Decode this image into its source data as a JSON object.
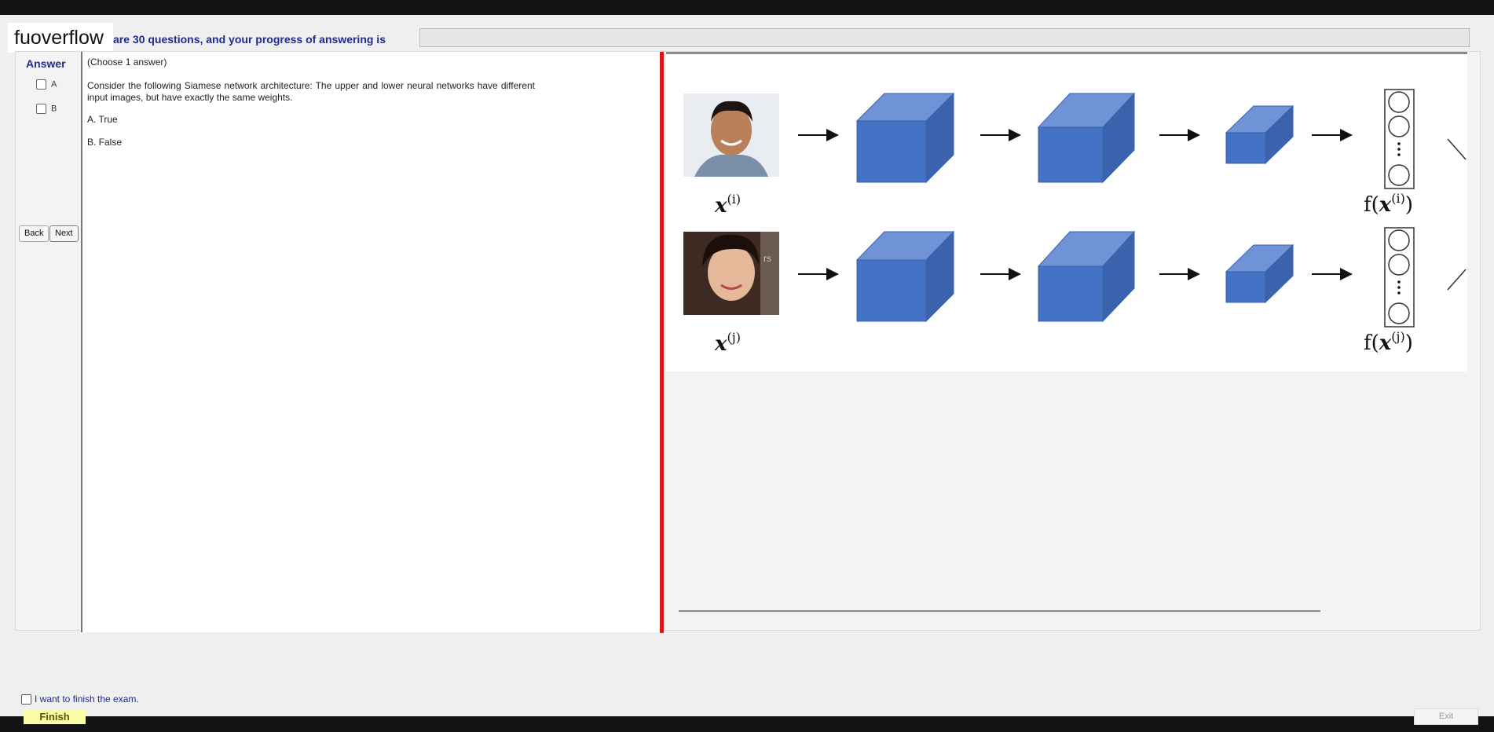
{
  "header": {
    "logo": "fuoverflow",
    "progress_text": "are 30 questions, and your progress of answering is",
    "progress_fraction": 0
  },
  "answer_panel": {
    "title": "Answer",
    "options": [
      {
        "label": "A",
        "checked": false
      },
      {
        "label": "B",
        "checked": false
      }
    ],
    "back_label": "Back",
    "next_label": "Next"
  },
  "question": {
    "choose": "(Choose 1 answer)",
    "text": "Consider the following Siamese network architecture: The upper and lower neural networks have different input images, but have exactly the same weights.",
    "option_a": "A. True",
    "option_b": "B. False"
  },
  "figure": {
    "top_input": "x",
    "top_input_sup": "(i)",
    "top_output_prefix": "f(",
    "top_output_var": "x",
    "top_output_sup": "(i)",
    "top_output_suffix": ")",
    "bottom_input": "x",
    "bottom_input_sup": "(j)",
    "bottom_output_prefix": "f(",
    "bottom_output_var": "x",
    "bottom_output_sup": "(j)",
    "bottom_output_suffix": ")",
    "cube_color": "#4472c4"
  },
  "footer": {
    "finish_check_label": "I want to finish the exam.",
    "finish_label": "Finish",
    "exit_label": "Exit"
  }
}
